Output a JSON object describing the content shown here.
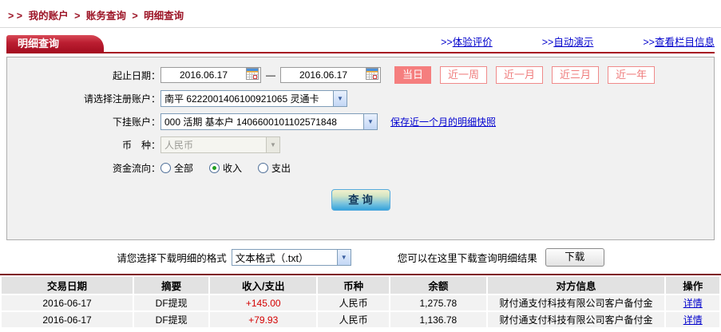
{
  "breadcrumb": {
    "prefix": "> >",
    "sep": ">",
    "items": [
      "我的账户",
      "账务查询",
      "明细查询"
    ]
  },
  "tab_title": "明细查询",
  "header_links": [
    {
      "prefix": ">>",
      "label": "体验评价"
    },
    {
      "prefix": ">>",
      "label": "自动演示"
    },
    {
      "prefix": ">>",
      "label": "查看栏目信息"
    }
  ],
  "form": {
    "date_label": "起止日期：",
    "date_from": "2016.06.17",
    "date_to": "2016.06.17",
    "date_separator": "—",
    "quick_buttons": [
      {
        "label": "当日",
        "active": true
      },
      {
        "label": "近一周",
        "active": false
      },
      {
        "label": "近一月",
        "active": false
      },
      {
        "label": "近三月",
        "active": false
      },
      {
        "label": "近一年",
        "active": false
      }
    ],
    "account_label": "请选择注册账户：",
    "account_value": "南平 6222001406100921065 灵通卡",
    "sub_account_label": "下挂账户：",
    "sub_account_value": "000 活期 基本户 1406600101102571848",
    "snapshot_link": "保存近一个月的明细快照",
    "currency_label": "币　种：",
    "currency_value": "人民币",
    "flow_label": "资金流向：",
    "flow_options": [
      {
        "label": "全部",
        "checked": false
      },
      {
        "label": "收入",
        "checked": true
      },
      {
        "label": "支出",
        "checked": false
      }
    ],
    "query_button": "查 询"
  },
  "download": {
    "format_label": "请您选择下载明细的格式",
    "format_value": "文本格式（.txt）",
    "hint": "您可以在这里下载查询明细结果",
    "button": "下载"
  },
  "table": {
    "headers": [
      "交易日期",
      "摘要",
      "收入/支出",
      "币种",
      "余额",
      "对方信息",
      "操作"
    ],
    "rows": [
      {
        "date": "2016-06-17",
        "summary": "DF提现",
        "amount": "+145.00",
        "currency": "人民币",
        "balance": "1,275.78",
        "counterparty": "财付通支付科技有限公司客户备付金",
        "action": "详情"
      },
      {
        "date": "2016-06-17",
        "summary": "DF提现",
        "amount": "+79.93",
        "currency": "人民币",
        "balance": "1,136.78",
        "counterparty": "财付通支付科技有限公司客户备付金",
        "action": "详情"
      }
    ]
  },
  "colors": {
    "brand_red": "#a60f22",
    "pink_button": "#f57e7e",
    "link_blue": "#0000cc",
    "amount_red": "#d40000",
    "table_divider": "#7d0d1d"
  }
}
